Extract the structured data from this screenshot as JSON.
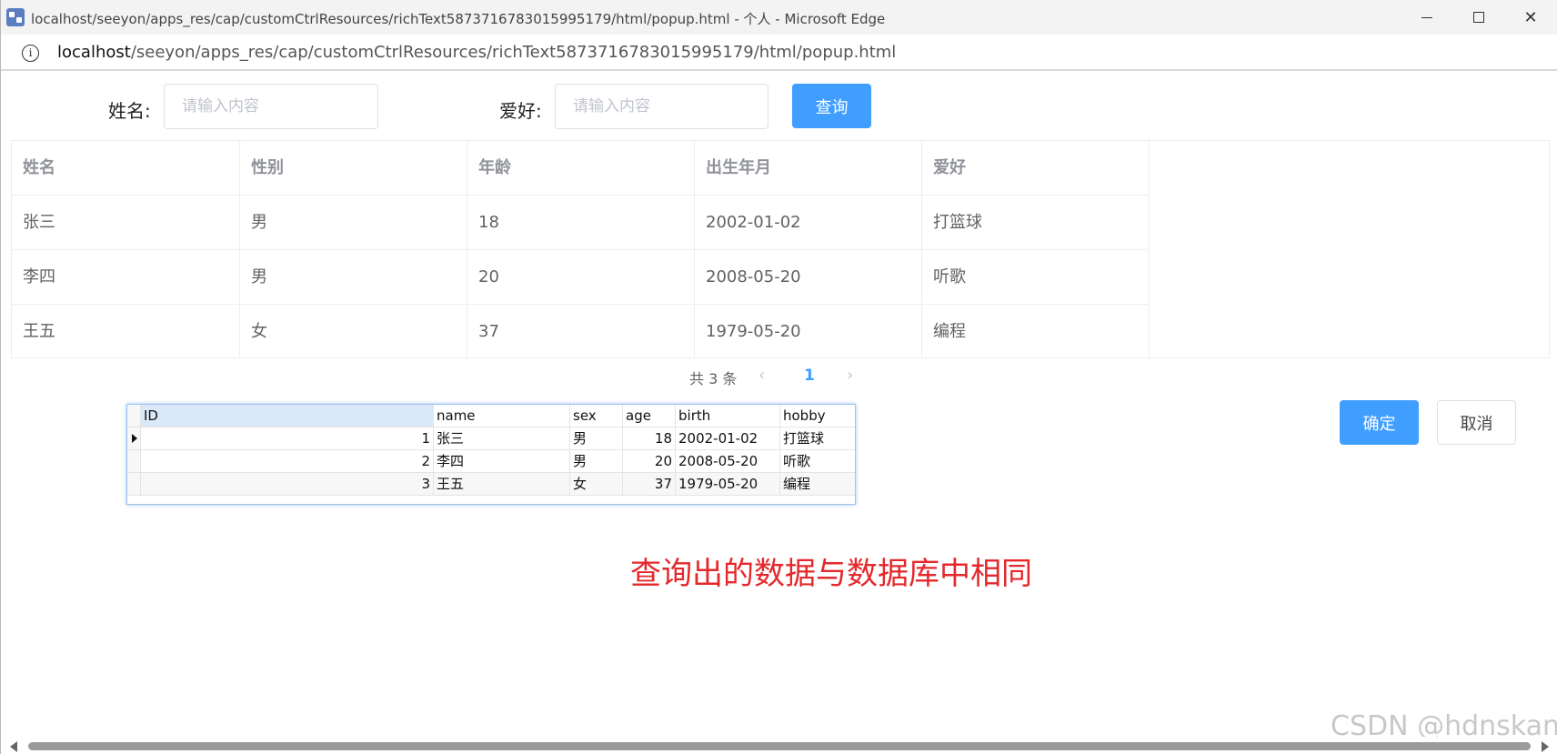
{
  "window": {
    "title": "localhost/seeyon/apps_res/cap/customCtrlResources/richText5873716783015995179/html/popup.html - 个人 - Microsoft Edge"
  },
  "address": {
    "host": "localhost",
    "path": "/seeyon/apps_res/cap/customCtrlResources/richText5873716783015995179/html/popup.html"
  },
  "search": {
    "name_label": "姓名:",
    "name_placeholder": "请输入内容",
    "hobby_label": "爱好:",
    "hobby_placeholder": "请输入内容",
    "query_button": "查询"
  },
  "table": {
    "columns": [
      "姓名",
      "性别",
      "年龄",
      "出生年月",
      "爱好"
    ],
    "rows": [
      [
        "张三",
        "男",
        "18",
        "2002-01-02",
        "打篮球"
      ],
      [
        "李四",
        "男",
        "20",
        "2008-05-20",
        "听歌"
      ],
      [
        "王五",
        "女",
        "37",
        "1979-05-20",
        "编程"
      ]
    ]
  },
  "pagination": {
    "total": "共 3 条",
    "current_page": "1",
    "prev_icon": "chevron-left-icon",
    "next_icon": "chevron-right-icon"
  },
  "actions": {
    "confirm": "确定",
    "cancel": "取消"
  },
  "db_grid": {
    "columns": [
      "ID",
      "name",
      "sex",
      "age",
      "birth",
      "hobby"
    ],
    "rows": [
      [
        "1",
        "张三",
        "男",
        "18",
        "2002-01-02",
        "打篮球"
      ],
      [
        "2",
        "李四",
        "男",
        "20",
        "2008-05-20",
        "听歌"
      ],
      [
        "3",
        "王五",
        "女",
        "37",
        "1979-05-20",
        "编程"
      ]
    ]
  },
  "annotation": "查询出的数据与数据库中相同",
  "watermark": "CSDN @hdnskan",
  "colors": {
    "primary": "#409eff",
    "annotation": "#e5282c"
  }
}
